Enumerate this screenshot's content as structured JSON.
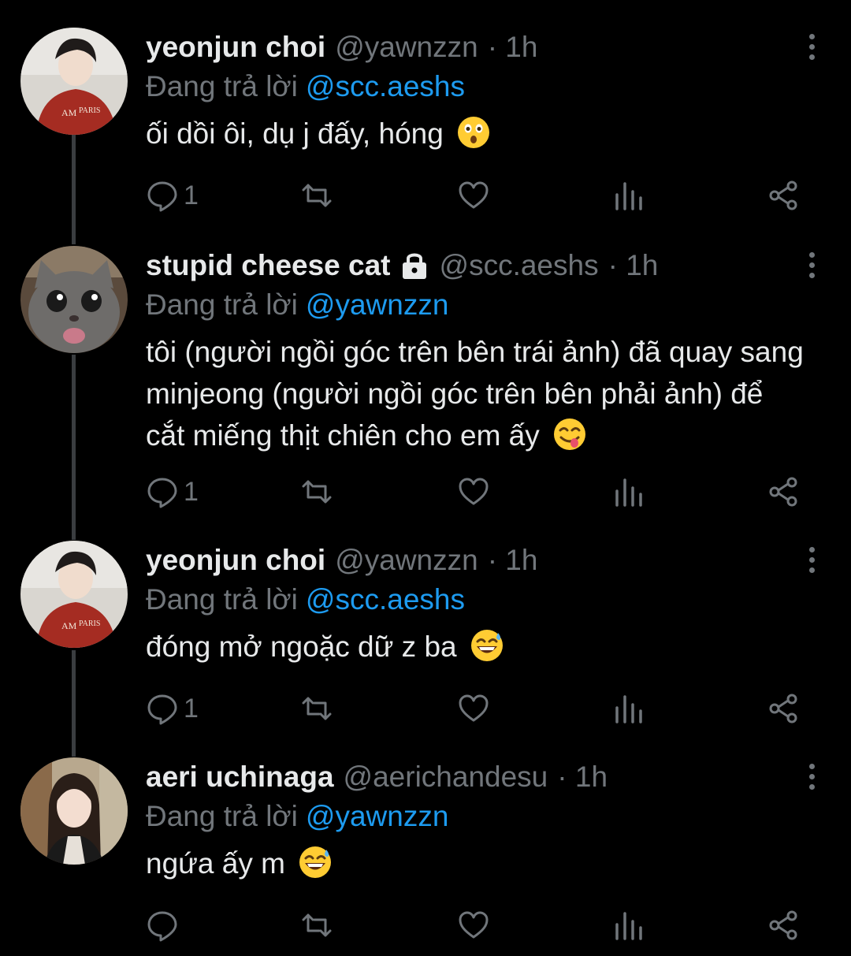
{
  "tweets": [
    {
      "name": "yeonjun choi",
      "handle": "@yawnzzn",
      "time": "· 1h",
      "reply_prefix": "Đang trả lời",
      "reply_to": "@scc.aeshs",
      "text": "ối dồi ôi, dụ j đấy, hóng",
      "emoji": "astonished-face",
      "reply_count": "1",
      "avatar": "person-red-hoodie",
      "locked": false
    },
    {
      "name": "stupid cheese cat",
      "handle": "@scc.aeshs",
      "time": "· 1h",
      "reply_prefix": "Đang trả lời",
      "reply_to": "@yawnzzn",
      "text": "tôi (người ngồi góc trên bên trái ảnh) đã quay sang minjeong (người ngồi góc trên bên phải ảnh) để cắt miếng thịt chiên cho em ấy",
      "emoji": "face-savoring-food",
      "reply_count": "1",
      "avatar": "gray-cat",
      "locked": true
    },
    {
      "name": "yeonjun choi",
      "handle": "@yawnzzn",
      "time": "· 1h",
      "reply_prefix": "Đang trả lời",
      "reply_to": "@scc.aeshs",
      "text": "đóng mở ngoặc dữ z ba",
      "emoji": "grinning-face-with-sweat",
      "reply_count": "1",
      "avatar": "person-red-hoodie",
      "locked": false
    },
    {
      "name": "aeri uchinaga",
      "handle": "@aerichandesu",
      "time": "· 1h",
      "reply_prefix": "Đang trả lời",
      "reply_to": "@yawnzzn",
      "text": "ngứa ấy m",
      "emoji": "grinning-face-with-sweat",
      "reply_count": "",
      "avatar": "person-long-hair",
      "locked": false
    }
  ],
  "colors": {
    "background": "#000000",
    "text": "#e7e9ea",
    "secondary": "#71767b",
    "link": "#1d9bf0",
    "thread_line": "#3a3d40"
  },
  "icons": [
    "reply-icon",
    "retweet-icon",
    "like-icon",
    "views-icon",
    "share-icon",
    "more-icon",
    "lock-icon"
  ]
}
